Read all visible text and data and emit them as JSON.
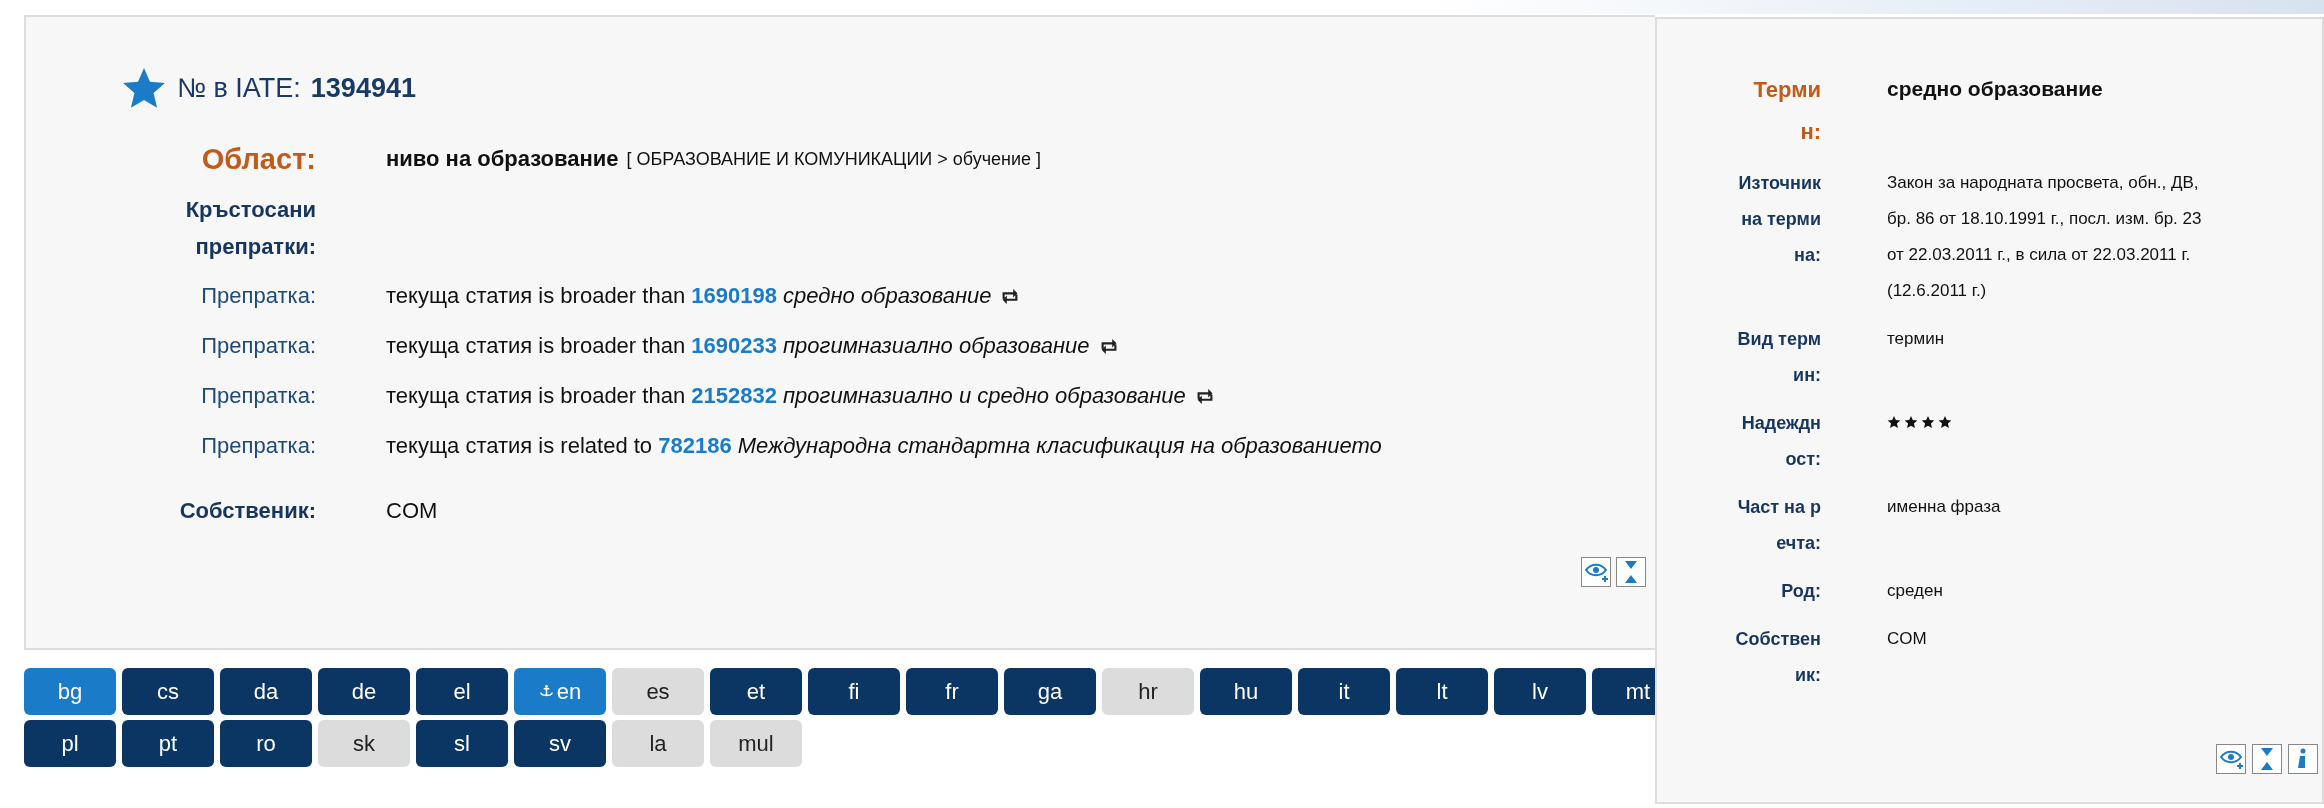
{
  "entry": {
    "number_label": "№ в IATE:",
    "number": "1394941",
    "domain": {
      "label": "Област:",
      "name": "ниво на образование",
      "path": "[ ОБРАЗОВАНИЕ И КОМУНИКАЦИИ > обучение ]"
    },
    "cross_refs_label": "Кръстосани препратки:",
    "references": [
      {
        "label": "Препратка:",
        "relation": "текуща статия is broader than",
        "id": "1690198",
        "term": "средно образование",
        "swap_icon": true
      },
      {
        "label": "Препратка:",
        "relation": "текуща статия is broader than",
        "id": "1690233",
        "term": "прогимназиално образование",
        "swap_icon": true
      },
      {
        "label": "Препратка:",
        "relation": "текуща статия is broader than",
        "id": "2152832",
        "term": "прогимназиално и средно образование",
        "swap_icon": true
      },
      {
        "label": "Препратка:",
        "relation": "текуща статия is related to",
        "id": "782186",
        "term": "Международна стандартна класификация на образованието",
        "swap_icon": false
      }
    ],
    "owner": {
      "label": "Собственик:",
      "value": "COM"
    }
  },
  "languages": [
    {
      "code": "bg",
      "kind": "selected"
    },
    {
      "code": "cs",
      "kind": "filled"
    },
    {
      "code": "da",
      "kind": "filled"
    },
    {
      "code": "de",
      "kind": "filled"
    },
    {
      "code": "el",
      "kind": "filled"
    },
    {
      "code": "en",
      "kind": "source"
    },
    {
      "code": "es",
      "kind": "empty"
    },
    {
      "code": "et",
      "kind": "filled"
    },
    {
      "code": "fi",
      "kind": "filled"
    },
    {
      "code": "fr",
      "kind": "filled"
    },
    {
      "code": "ga",
      "kind": "filled"
    },
    {
      "code": "hr",
      "kind": "empty"
    },
    {
      "code": "hu",
      "kind": "filled"
    },
    {
      "code": "it",
      "kind": "filled"
    },
    {
      "code": "lt",
      "kind": "filled"
    },
    {
      "code": "lv",
      "kind": "filled"
    },
    {
      "code": "mt",
      "kind": "filled"
    },
    {
      "code": "pl",
      "kind": "filled"
    },
    {
      "code": "pt",
      "kind": "filled"
    },
    {
      "code": "ro",
      "kind": "filled"
    },
    {
      "code": "sk",
      "kind": "empty"
    },
    {
      "code": "sl",
      "kind": "filled"
    },
    {
      "code": "sv",
      "kind": "filled"
    },
    {
      "code": "la",
      "kind": "empty"
    },
    {
      "code": "mul",
      "kind": "empty"
    }
  ],
  "term_panel": {
    "fields": [
      {
        "label": "Термин:",
        "value": "средно образование",
        "kind": "term"
      },
      {
        "label": "Източник на термина:",
        "value": "Закон за народната просвета, обн., ДВ, бр. 86 от 18.10.1991 г., посл. изм. бр. 23 от 22.03.2011 г., в сила от 22.03.2011 г. (12.6.2011 г.)",
        "kind": "text"
      },
      {
        "label": "Вид термин:",
        "value": "термин",
        "kind": "text"
      },
      {
        "label": "Надеждност:",
        "stars": 4,
        "kind": "stars"
      },
      {
        "label": "Част на речта:",
        "value": "именна фраза",
        "kind": "text"
      },
      {
        "label": "Род:",
        "value": "среден",
        "kind": "text"
      },
      {
        "label": "Собственик:",
        "value": "COM",
        "kind": "owner"
      }
    ]
  }
}
